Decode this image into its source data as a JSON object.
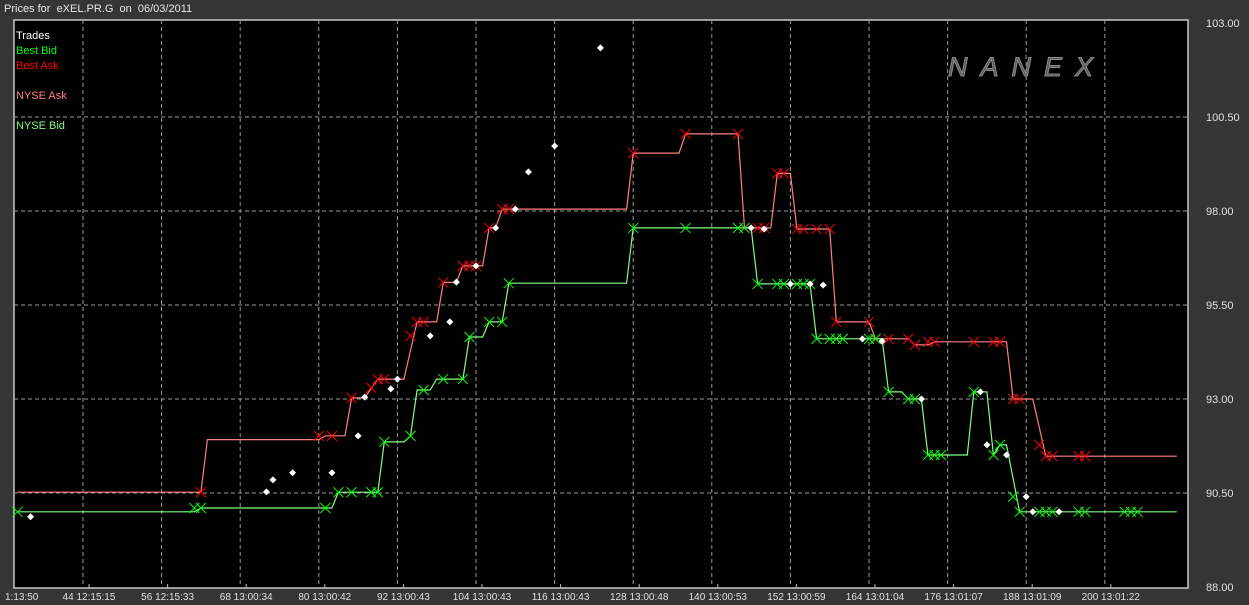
{
  "header": {
    "title": "Prices for  eXEL.PR.G  on  06/03/2011"
  },
  "watermark": "NANEX",
  "legend": [
    {
      "label": "Trades",
      "color": "#ffffff"
    },
    {
      "label": "Best Bid",
      "color": "#00ff00"
    },
    {
      "label": "Best Ask",
      "color": "#ff0000"
    },
    {
      "label": "NYSE Ask",
      "color": "#ff8080"
    },
    {
      "label": "NYSE Bid",
      "color": "#80ff80"
    }
  ],
  "chart_data": {
    "type": "line",
    "title": "Prices for eXEL.PR.G on 06/03/2011",
    "xlabel": "",
    "ylabel": "",
    "ylim": [
      88.0,
      103.0
    ],
    "xlim": [
      32,
      211
    ],
    "grid": true,
    "legend_position": "top-left",
    "y_ticks": [
      {
        "value": 103.0,
        "label": "103.00"
      },
      {
        "value": 100.5,
        "label": "100.50"
      },
      {
        "value": 98.0,
        "label": "98.00"
      },
      {
        "value": 95.5,
        "label": "95.50"
      },
      {
        "value": 93.0,
        "label": "93.00"
      },
      {
        "value": 90.5,
        "label": "90.50"
      },
      {
        "value": 88.0,
        "label": "88.00"
      }
    ],
    "x_ticks": [
      {
        "idx": 32,
        "label": "1:13:50"
      },
      {
        "idx": 44,
        "label": "44 12:15:15"
      },
      {
        "idx": 56,
        "label": "56 12:15:33"
      },
      {
        "idx": 68,
        "label": "68 13:00:34"
      },
      {
        "idx": 80,
        "label": "80 13:00:42"
      },
      {
        "idx": 92,
        "label": "92 13:00:43"
      },
      {
        "idx": 104,
        "label": "104 13:00:43"
      },
      {
        "idx": 116,
        "label": "116 13:00:43"
      },
      {
        "idx": 128,
        "label": "128 13:00:48"
      },
      {
        "idx": 140,
        "label": "140 13:00:53"
      },
      {
        "idx": 152,
        "label": "152 13:00:59"
      },
      {
        "idx": 164,
        "label": "164 13:01:04"
      },
      {
        "idx": 176,
        "label": "176 13:01:07"
      },
      {
        "idx": 188,
        "label": "188 13:01:09"
      },
      {
        "idx": 200,
        "label": "200 13:01:22"
      }
    ],
    "series": [
      {
        "name": "NYSE Ask",
        "kind": "line",
        "color": "#ff8080",
        "points": [
          [
            34,
            90.52
          ],
          [
            62,
            90.52
          ],
          [
            63,
            91.92
          ],
          [
            80,
            91.92
          ],
          [
            81,
            92.02
          ],
          [
            84,
            92.02
          ],
          [
            85,
            93.03
          ],
          [
            87,
            93.03
          ],
          [
            89,
            93.53
          ],
          [
            93,
            93.53
          ],
          [
            95,
            95.05
          ],
          [
            98,
            95.05
          ],
          [
            99,
            96.1
          ],
          [
            101,
            96.1
          ],
          [
            102,
            96.54
          ],
          [
            105,
            96.54
          ],
          [
            106,
            97.55
          ],
          [
            107,
            97.55
          ],
          [
            108,
            98.05
          ],
          [
            127,
            98.05
          ],
          [
            128,
            99.54
          ],
          [
            135,
            99.54
          ],
          [
            136,
            100.05
          ],
          [
            144,
            100.05
          ],
          [
            145,
            97.55
          ],
          [
            149,
            97.55
          ],
          [
            150,
            99.0
          ],
          [
            152,
            99.0
          ],
          [
            153,
            97.52
          ],
          [
            158,
            97.52
          ],
          [
            159,
            95.05
          ],
          [
            164,
            95.05
          ],
          [
            165,
            94.6
          ],
          [
            170,
            94.6
          ],
          [
            171,
            94.44
          ],
          [
            173,
            94.44
          ],
          [
            174,
            94.52
          ],
          [
            185,
            94.52
          ],
          [
            186,
            93.0
          ],
          [
            189,
            93.0
          ],
          [
            191,
            91.48
          ],
          [
            211,
            91.48
          ]
        ]
      },
      {
        "name": "NYSE Bid",
        "kind": "line",
        "color": "#80ff80",
        "points": [
          [
            34,
            90.0
          ],
          [
            61,
            90.0
          ],
          [
            62,
            90.1
          ],
          [
            82,
            90.1
          ],
          [
            83,
            90.52
          ],
          [
            89,
            90.52
          ],
          [
            90,
            91.86
          ],
          [
            93,
            91.86
          ],
          [
            94,
            92.02
          ],
          [
            95,
            93.24
          ],
          [
            97,
            93.24
          ],
          [
            98,
            93.53
          ],
          [
            102,
            93.53
          ],
          [
            103,
            94.65
          ],
          [
            105,
            94.65
          ],
          [
            106,
            95.05
          ],
          [
            108,
            95.05
          ],
          [
            109,
            96.08
          ],
          [
            127,
            96.08
          ],
          [
            128,
            97.55
          ],
          [
            146,
            97.55
          ],
          [
            147,
            96.06
          ],
          [
            155,
            96.06
          ],
          [
            156,
            94.6
          ],
          [
            166,
            94.6
          ],
          [
            167,
            93.19
          ],
          [
            169,
            93.19
          ],
          [
            170,
            93.0
          ],
          [
            172,
            93.0
          ],
          [
            173,
            91.51
          ],
          [
            179,
            91.51
          ],
          [
            180,
            93.19
          ],
          [
            182,
            93.19
          ],
          [
            183,
            91.51
          ],
          [
            184,
            91.78
          ],
          [
            185,
            91.78
          ],
          [
            187,
            90.0
          ],
          [
            211,
            90.0
          ]
        ]
      },
      {
        "name": "Best Ask",
        "kind": "marker-x",
        "color": "#ff0000",
        "points": [
          [
            62,
            90.52
          ],
          [
            80,
            92.02
          ],
          [
            82,
            92.02
          ],
          [
            85,
            93.03
          ],
          [
            88,
            93.3
          ],
          [
            89,
            93.53
          ],
          [
            90,
            93.53
          ],
          [
            94,
            94.68
          ],
          [
            95,
            95.05
          ],
          [
            96,
            95.05
          ],
          [
            99,
            96.1
          ],
          [
            102,
            96.54
          ],
          [
            103,
            96.54
          ],
          [
            104,
            96.54
          ],
          [
            106,
            97.55
          ],
          [
            108,
            98.05
          ],
          [
            109,
            98.05
          ],
          [
            128,
            99.54
          ],
          [
            136,
            100.05
          ],
          [
            144,
            100.05
          ],
          [
            145,
            97.55
          ],
          [
            147,
            97.55
          ],
          [
            148,
            97.55
          ],
          [
            150,
            99.0
          ],
          [
            151,
            99.0
          ],
          [
            153,
            97.52
          ],
          [
            154,
            97.52
          ],
          [
            156,
            97.52
          ],
          [
            158,
            97.52
          ],
          [
            159,
            95.05
          ],
          [
            164,
            95.05
          ],
          [
            165,
            94.6
          ],
          [
            167,
            94.6
          ],
          [
            170,
            94.6
          ],
          [
            171,
            94.44
          ],
          [
            173,
            94.52
          ],
          [
            174,
            94.52
          ],
          [
            180,
            94.52
          ],
          [
            183,
            94.52
          ],
          [
            184,
            94.52
          ],
          [
            186,
            93.0
          ],
          [
            187,
            93.0
          ],
          [
            190,
            91.78
          ],
          [
            191,
            91.48
          ],
          [
            192,
            91.48
          ],
          [
            196,
            91.48
          ],
          [
            197,
            91.48
          ]
        ]
      },
      {
        "name": "Best Bid",
        "kind": "marker-x",
        "color": "#00ff00",
        "points": [
          [
            34,
            90.0
          ],
          [
            61,
            90.1
          ],
          [
            62,
            90.1
          ],
          [
            81,
            90.1
          ],
          [
            83,
            90.52
          ],
          [
            85,
            90.52
          ],
          [
            88,
            90.52
          ],
          [
            89,
            90.52
          ],
          [
            90,
            91.86
          ],
          [
            94,
            92.02
          ],
          [
            96,
            93.24
          ],
          [
            99,
            93.53
          ],
          [
            102,
            93.53
          ],
          [
            103,
            94.65
          ],
          [
            106,
            95.05
          ],
          [
            108,
            95.05
          ],
          [
            109,
            96.08
          ],
          [
            128,
            97.55
          ],
          [
            136,
            97.55
          ],
          [
            144,
            97.55
          ],
          [
            145,
            97.55
          ],
          [
            147,
            96.06
          ],
          [
            150,
            96.06
          ],
          [
            151,
            96.06
          ],
          [
            153,
            96.06
          ],
          [
            154,
            96.06
          ],
          [
            155,
            96.06
          ],
          [
            156,
            94.6
          ],
          [
            158,
            94.6
          ],
          [
            159,
            94.6
          ],
          [
            160,
            94.6
          ],
          [
            164,
            94.6
          ],
          [
            165,
            94.6
          ],
          [
            167,
            93.19
          ],
          [
            170,
            93.0
          ],
          [
            171,
            93.0
          ],
          [
            173,
            91.51
          ],
          [
            174,
            91.51
          ],
          [
            175,
            91.51
          ],
          [
            180,
            93.19
          ],
          [
            183,
            91.51
          ],
          [
            184,
            91.78
          ],
          [
            186,
            90.4
          ],
          [
            187,
            90.0
          ],
          [
            190,
            90.0
          ],
          [
            191,
            90.0
          ],
          [
            192,
            90.0
          ],
          [
            196,
            90.0
          ],
          [
            197,
            90.0
          ],
          [
            203,
            90.0
          ],
          [
            204,
            90.0
          ],
          [
            205,
            90.0
          ]
        ]
      },
      {
        "name": "Trades",
        "kind": "marker-diamond",
        "color": "#ffffff",
        "points": [
          [
            36,
            89.87
          ],
          [
            72,
            90.53
          ],
          [
            73,
            90.85
          ],
          [
            76,
            91.04
          ],
          [
            82,
            91.04
          ],
          [
            86,
            92.02
          ],
          [
            87,
            93.05
          ],
          [
            91,
            93.27
          ],
          [
            92,
            93.53
          ],
          [
            97,
            94.68
          ],
          [
            100,
            95.05
          ],
          [
            101,
            96.11
          ],
          [
            104,
            96.54
          ],
          [
            107,
            97.55
          ],
          [
            110,
            98.05
          ],
          [
            112,
            99.04
          ],
          [
            116,
            99.73
          ],
          [
            123,
            102.34
          ],
          [
            146,
            97.55
          ],
          [
            148,
            97.52
          ],
          [
            152,
            96.06
          ],
          [
            155,
            96.06
          ],
          [
            157,
            96.03
          ],
          [
            163,
            94.6
          ],
          [
            166,
            94.54
          ],
          [
            172,
            93.0
          ],
          [
            181,
            93.19
          ],
          [
            182,
            91.78
          ],
          [
            185,
            91.51
          ],
          [
            188,
            90.4
          ],
          [
            189,
            90.0
          ],
          [
            193,
            90.0
          ]
        ]
      }
    ]
  }
}
